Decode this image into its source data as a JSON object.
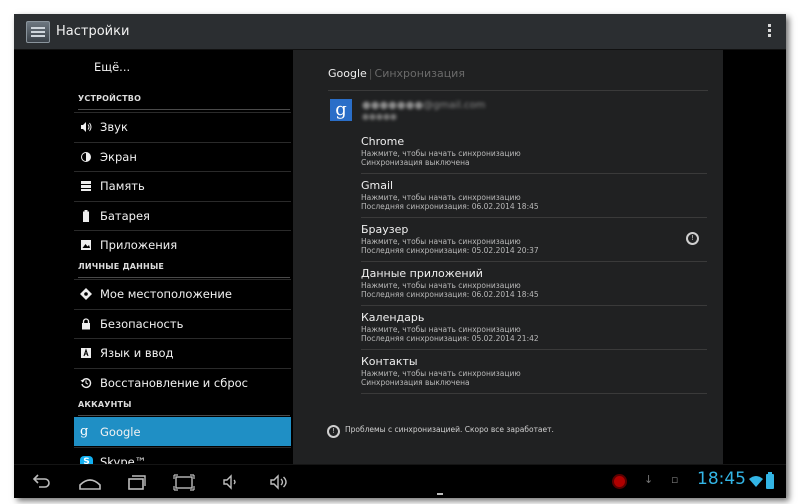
{
  "app": {
    "title": "Настройки"
  },
  "headers": {
    "more_label": "Ещё...",
    "categories": {
      "device": "УСТРОЙСТВО",
      "personal": "ЛИЧНЫЕ ДАННЫЕ",
      "accounts": "АККАУНТЫ"
    },
    "items": [
      {
        "label": "Звук",
        "icon": "speaker-icon"
      },
      {
        "label": "Экран",
        "icon": "brightness-icon"
      },
      {
        "label": "Память",
        "icon": "storage-icon"
      },
      {
        "label": "Батарея",
        "icon": "battery-icon"
      },
      {
        "label": "Приложения",
        "icon": "apps-icon"
      },
      {
        "label": "Мое местоположение",
        "icon": "location-icon"
      },
      {
        "label": "Безопасность",
        "icon": "lock-icon"
      },
      {
        "label": "Язык и ввод",
        "icon": "keyboard-icon"
      },
      {
        "label": "Восстановление и сброс",
        "icon": "restore-icon"
      },
      {
        "label": "Google",
        "icon": "google-icon",
        "selected": true
      },
      {
        "label": "Skype™",
        "icon": "skype-icon"
      }
    ]
  },
  "pane": {
    "breadcrumb": {
      "account": "Google",
      "section": "Синхронизация"
    },
    "sync_items": [
      {
        "title": "Chrome",
        "line1": "Нажмите, чтобы начать синхронизацию",
        "line2": "Синхронизация выключена",
        "status_icon": false
      },
      {
        "title": "Gmail",
        "line1": "Нажмите, чтобы начать синхронизацию",
        "line2": "Последняя синхронизация: 06.02.2014 18:45",
        "status_icon": false
      },
      {
        "title": "Браузер",
        "line1": "Нажмите, чтобы начать синхронизацию",
        "line2": "Последняя синхронизация: 05.02.2014 20:37",
        "status_icon": true
      },
      {
        "title": "Данные приложений",
        "line1": "Нажмите, чтобы начать синхронизацию",
        "line2": "Последняя синхронизация: 06.02.2014 18:45",
        "status_icon": false
      },
      {
        "title": "Календарь",
        "line1": "Нажмите, чтобы начать синхронизацию",
        "line2": "Последняя синхронизация: 05.02.2014 21:42",
        "status_icon": false
      },
      {
        "title": "Контакты",
        "line1": "Нажмите, чтобы начать синхронизацию",
        "line2": "Синхронизация выключена",
        "status_icon": false
      }
    ],
    "problem_text": "Проблемы с синхронизацией. Скоро все заработает."
  },
  "status": {
    "clock": "18:45",
    "clock_color": "#33b5e5",
    "selected_color": "#1f8fc5"
  }
}
